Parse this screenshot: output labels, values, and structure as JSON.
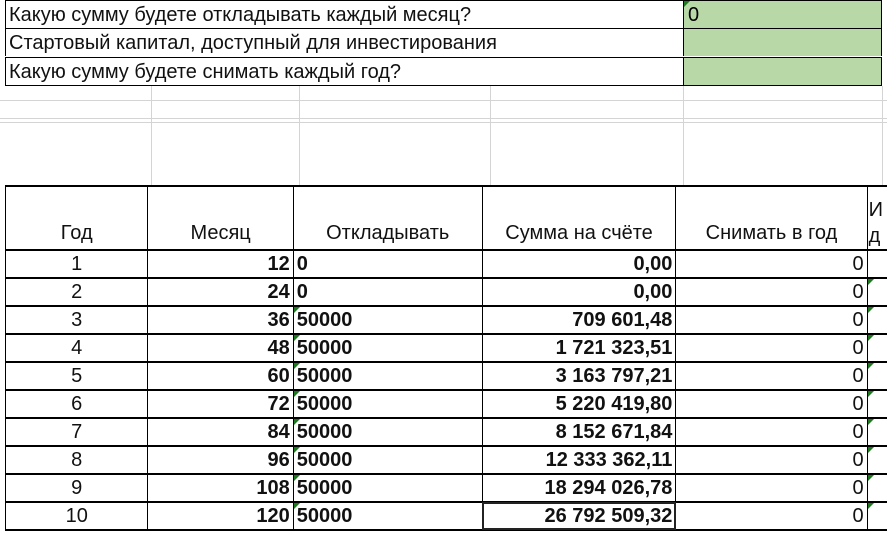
{
  "inputs": [
    {
      "label": "Какую сумму будете откладывать каждый месяц?",
      "value": "0"
    },
    {
      "label": "Стартовый капитал, доступный для инвестирования",
      "value": ""
    },
    {
      "label": "Какую сумму будете снимать каждый год?",
      "value": ""
    }
  ],
  "table": {
    "headers": [
      "Год",
      "Месяц",
      "Откладывать",
      "Сумма на счёте",
      "Снимать в год",
      "И д"
    ],
    "rows": [
      {
        "year": "1",
        "month": "12",
        "save": "0",
        "balance": "0,00",
        "withdraw": "0"
      },
      {
        "year": "2",
        "month": "24",
        "save": "0",
        "balance": "0,00",
        "withdraw": "0"
      },
      {
        "year": "3",
        "month": "36",
        "save": "50000",
        "balance": "709 601,48",
        "withdraw": "0"
      },
      {
        "year": "4",
        "month": "48",
        "save": "50000",
        "balance": "1 721 323,51",
        "withdraw": "0"
      },
      {
        "year": "5",
        "month": "60",
        "save": "50000",
        "balance": "3 163 797,21",
        "withdraw": "0"
      },
      {
        "year": "6",
        "month": "72",
        "save": "50000",
        "balance": "5 220 419,80",
        "withdraw": "0"
      },
      {
        "year": "7",
        "month": "84",
        "save": "50000",
        "balance": "8 152 671,84",
        "withdraw": "0"
      },
      {
        "year": "8",
        "month": "96",
        "save": "50000",
        "balance": "12 333 362,11",
        "withdraw": "0"
      },
      {
        "year": "9",
        "month": "108",
        "save": "50000",
        "balance": "18 294 026,78",
        "withdraw": "0"
      },
      {
        "year": "10",
        "month": "120",
        "save": "50000",
        "balance": "26 792 509,32",
        "withdraw": "0"
      }
    ]
  },
  "colors": {
    "input_fill": "#b8d8a8",
    "marker": "#1e7a1e"
  }
}
